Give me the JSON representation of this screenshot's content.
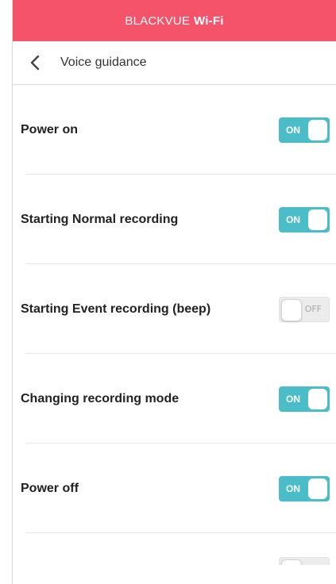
{
  "app": {
    "brand": "BLACKVUE",
    "brand_suffix": "Wi-Fi"
  },
  "nav": {
    "title": "Voice guidance"
  },
  "settings": [
    {
      "label": "Power on",
      "state": "ON"
    },
    {
      "label": "Starting Normal recording",
      "state": "ON"
    },
    {
      "label": "Starting Event recording (beep)",
      "state": "OFF"
    },
    {
      "label": "Changing recording mode",
      "state": "ON"
    },
    {
      "label": "Power off",
      "state": "ON"
    }
  ],
  "colors": {
    "header": "#f5536a",
    "toggle_on": "#4bbdc8",
    "toggle_off": "#ececec"
  }
}
